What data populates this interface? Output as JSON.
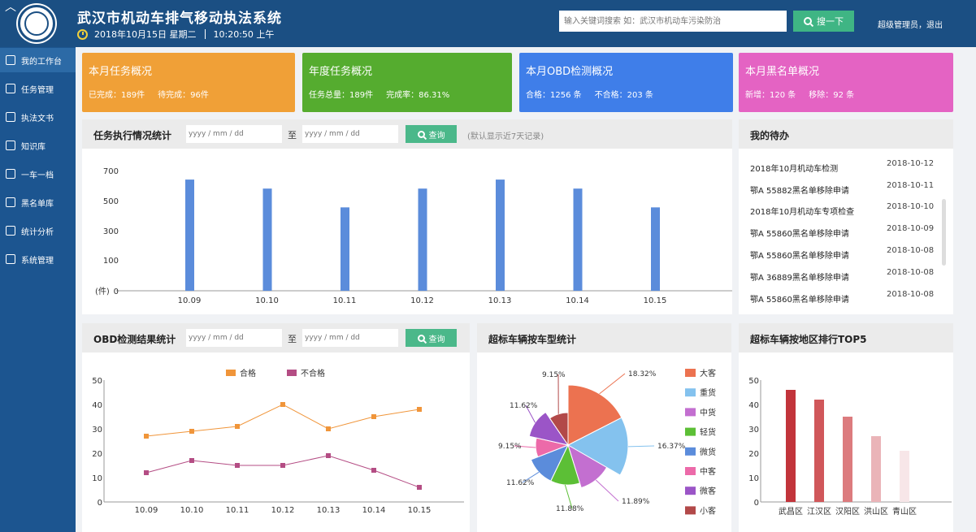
{
  "header": {
    "title": "武汉市机动车排气移动执法系统",
    "date": "2018年10月15日 星期二",
    "time": "10:20:50 上午",
    "search_placeholder": "输入关键词搜索 如：武汉市机动车污染防治",
    "search_button": "搜一下",
    "user": "超级管理员，退出"
  },
  "sidebar": {
    "items": [
      {
        "label": "我的工作台",
        "icon": "dashboard-icon"
      },
      {
        "label": "任务管理",
        "icon": "list-icon"
      },
      {
        "label": "执法文书",
        "icon": "document-icon"
      },
      {
        "label": "知识库",
        "icon": "book-icon"
      },
      {
        "label": "一车一档",
        "icon": "car-icon"
      },
      {
        "label": "黑名单库",
        "icon": "user-icon"
      },
      {
        "label": "统计分析",
        "icon": "pie-icon"
      },
      {
        "label": "系统管理",
        "icon": "gear-icon"
      }
    ]
  },
  "cards": [
    {
      "title": "本月任务概况",
      "stat1": "已完成：189件",
      "stat2": "待完成：96件",
      "color": "#f0a037"
    },
    {
      "title": "年度任务概况",
      "stat1": "任务总量：189件",
      "stat2": "完成率：86.31%",
      "color": "#55ac2f"
    },
    {
      "title": "本月OBD检测概况",
      "stat1": "合格：1256 条",
      "stat2": "不合格：203 条",
      "color": "#3f7ee9"
    },
    {
      "title": "本月黑名单概况",
      "stat1": "新增：120 条",
      "stat2": "移除：92 条",
      "color": "#e463c3"
    }
  ],
  "task_panel": {
    "title": "任务执行情况统计",
    "date_placeholder": "yyyy / mm / dd",
    "to": "至",
    "query": "查询",
    "hint": "(默认显示近7天记录)"
  },
  "obd_panel": {
    "title": "OBD检测结果统计",
    "date_placeholder": "yyyy / mm / dd",
    "to": "至",
    "query": "查询"
  },
  "vehicle_panel": {
    "title": "超标车辆按车型统计"
  },
  "region_panel": {
    "title": "超标车辆按地区排行TOP5"
  },
  "todo": {
    "title": "我的待办",
    "items": [
      {
        "text": "2018年10月机动车检测",
        "date": "2018-10-12"
      },
      {
        "text": "鄂A 55882黑名单移除申请",
        "date": "2018-10-11"
      },
      {
        "text": "2018年10月机动车专项检查",
        "date": "2018-10-10"
      },
      {
        "text": "鄂A 55860黑名单移除申请",
        "date": "2018-10-09"
      },
      {
        "text": "鄂A 55860黑名单移除申请",
        "date": "2018-10-08"
      },
      {
        "text": "鄂A 36889黑名单移除申请",
        "date": "2018-10-08"
      },
      {
        "text": "鄂A 55860黑名单移除申请",
        "date": "2018-10-08"
      }
    ]
  },
  "chart_data": [
    {
      "type": "bar",
      "categories": [
        "10.09",
        "10.10",
        "10.11",
        "10.12",
        "10.13",
        "10.14",
        "10.15"
      ],
      "values": [
        640,
        580,
        455,
        580,
        640,
        580,
        455
      ],
      "yticks": [
        0,
        100,
        300,
        500,
        700
      ],
      "yunit": "(件)",
      "color": "#5b8cdb"
    },
    {
      "type": "line",
      "categories": [
        "10.09",
        "10.10",
        "10.11",
        "10.12",
        "10.13",
        "10.14",
        "10.15"
      ],
      "ylim": [
        0,
        50
      ],
      "yticks": [
        0,
        10,
        20,
        30,
        40,
        50
      ],
      "legend_position": "top",
      "series": [
        {
          "name": "合格",
          "values": [
            27,
            29,
            31,
            40,
            30,
            35,
            38
          ],
          "color": "#f0953a"
        },
        {
          "name": "不合格",
          "values": [
            12,
            17,
            15,
            15,
            19,
            13,
            6
          ],
          "color": "#b44d84"
        }
      ]
    },
    {
      "type": "pie",
      "slices": [
        {
          "name": "大客",
          "value": 18.32,
          "label": "18.32%",
          "color": "#ec7250"
        },
        {
          "name": "重货",
          "value": 16.37,
          "label": "16.37%",
          "color": "#84c2ee"
        },
        {
          "name": "中货",
          "value": 11.89,
          "label": "11.89%",
          "color": "#c36fd0"
        },
        {
          "name": "轻货",
          "value": 11.88,
          "label": "11.88%",
          "color": "#5cbf36"
        },
        {
          "name": "微货",
          "value": 11.62,
          "label": "11.62%",
          "color": "#5b8cdb"
        },
        {
          "name": "中客",
          "value": 9.15,
          "label": "9.15%",
          "color": "#ec6aa9"
        },
        {
          "name": "微客",
          "value": 11.62,
          "label": "11.62%",
          "color": "#9b55c7"
        },
        {
          "name": "小客",
          "value": 9.15,
          "label": "9.15%",
          "color": "#b24949"
        }
      ]
    },
    {
      "type": "bar",
      "categories": [
        "武昌区",
        "江汉区",
        "汉阳区",
        "洪山区",
        "青山区"
      ],
      "values": [
        46,
        42,
        35,
        27,
        21
      ],
      "ylim": [
        0,
        50
      ],
      "yticks": [
        0,
        10,
        20,
        30,
        40,
        50
      ],
      "colors": [
        "#c2343b",
        "#d0575a",
        "#dc7b7e",
        "#eab4b8",
        "#f7e6e8"
      ]
    }
  ]
}
